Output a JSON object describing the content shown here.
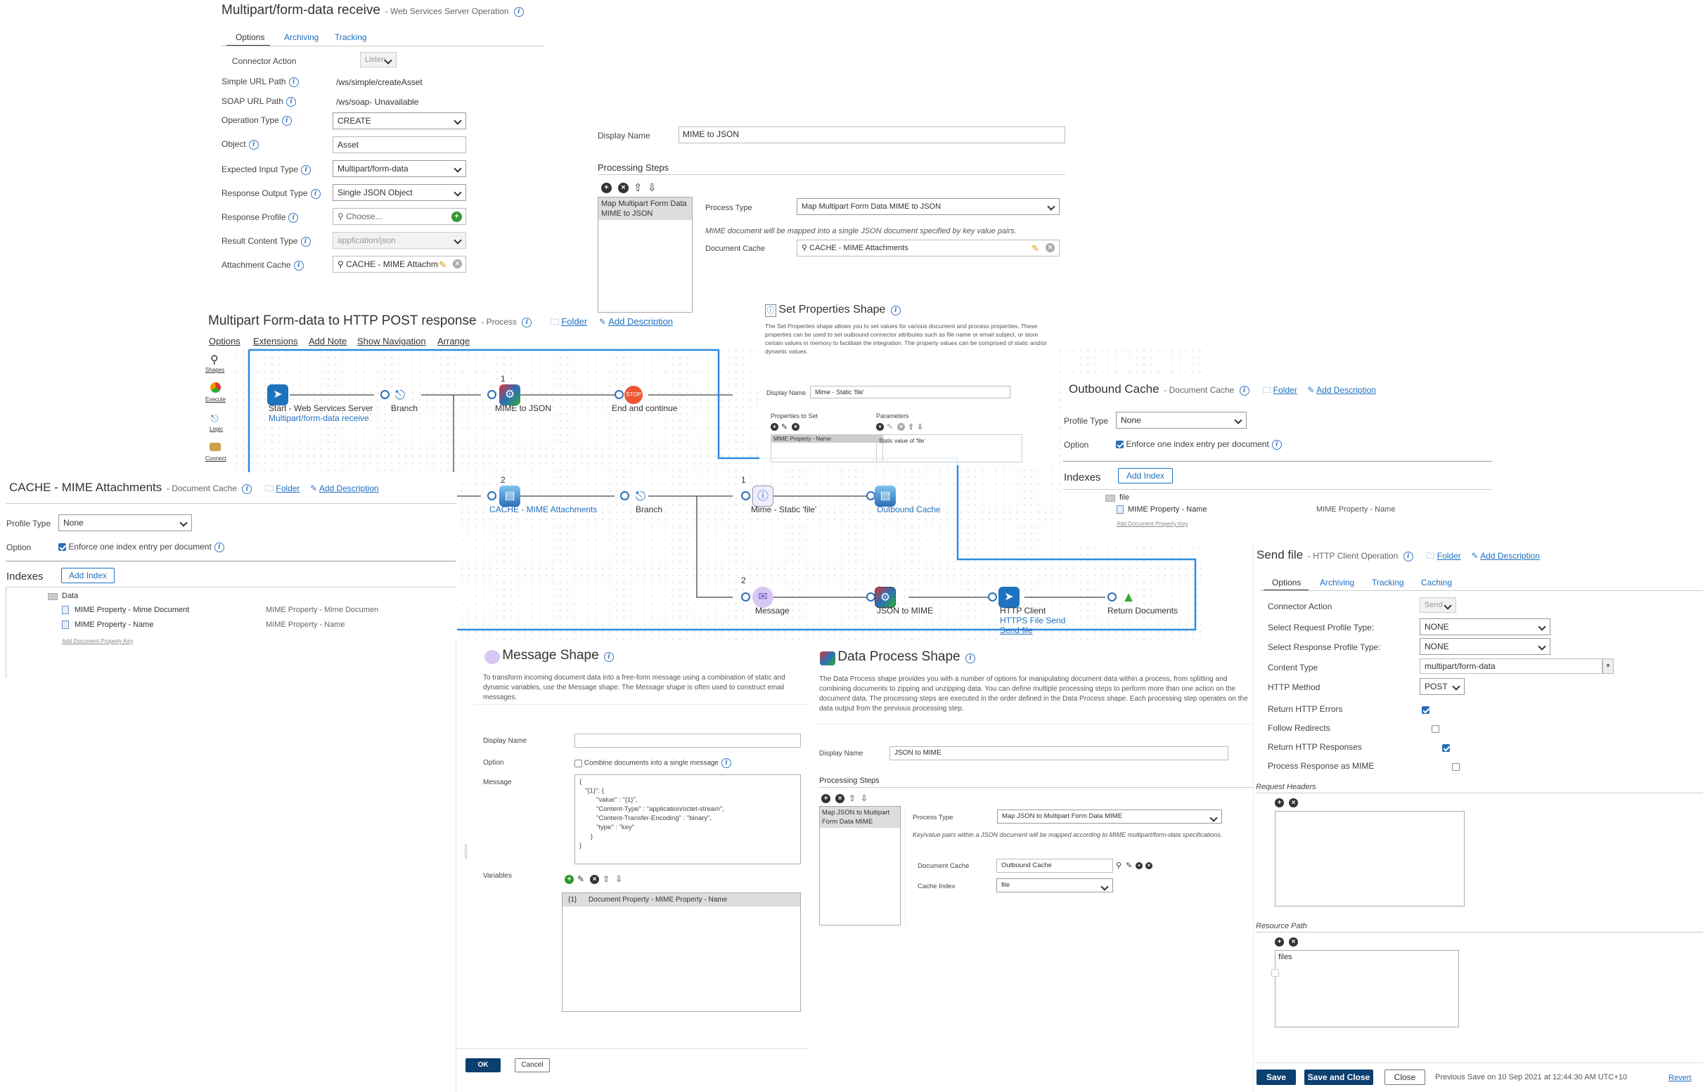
{
  "ws_op": {
    "title": "Multipart/form-data receive",
    "subtitle": "Web Services Server Operation",
    "tabs": [
      "Options",
      "Archiving",
      "Tracking"
    ],
    "connector_action_label": "Connector Action",
    "connector_action_value": "Listen",
    "fields": {
      "simple_url_label": "Simple URL Path",
      "simple_url_value": "/ws/simple/createAsset",
      "soap_url_label": "SOAP URL Path",
      "soap_url_value": "/ws/soap- Unavailable",
      "operation_type_label": "Operation Type",
      "operation_type_value": "CREATE",
      "object_label": "Object",
      "object_value": "Asset",
      "input_type_label": "Expected Input Type",
      "input_type_value": "Multipart/form-data",
      "output_type_label": "Response Output Type",
      "output_type_value": "Single JSON Object",
      "response_profile_label": "Response Profile",
      "response_profile_placeholder": "Choose...",
      "result_content_label": "Result Content Type",
      "result_content_value": "application/json",
      "attachment_cache_label": "Attachment Cache",
      "attachment_cache_value": "CACHE - MIME Attachm"
    }
  },
  "dp1": {
    "display_name_label": "Display Name",
    "display_name_value": "MIME to JSON",
    "processing_steps_label": "Processing Steps",
    "step_item": "Map Multipart Form Data MIME to JSON",
    "process_type_label": "Process Type",
    "process_type_value": "Map Multipart Form Data MIME to JSON",
    "note": "MIME document will be mapped into a single JSON document specified by key value pairs.",
    "doc_cache_label": "Document Cache",
    "doc_cache_value": "CACHE - MIME Attachments"
  },
  "process": {
    "title": "Multipart Form-data to HTTP POST response",
    "subtitle": "Process",
    "folder": "Folder",
    "add_description": "Add Description",
    "tabs": [
      "Options",
      "Extensions",
      "Add Note",
      "Show Navigation",
      "Arrange"
    ],
    "palette": [
      "Shapes",
      "Execute",
      "Logic",
      "Connect"
    ],
    "nodes": {
      "start": "Start - Web Services Server",
      "start_sub": "Multipart/form-data receive",
      "branch1": "Branch",
      "mime_to_json": "MIME to JSON",
      "end_continue": "End and continue",
      "cache": "CACHE - MIME Attachments",
      "branch2": "Branch",
      "mime_static": "Mime - Static 'file'",
      "outbound_cache": "Outbound Cache",
      "message": "Message",
      "json_to_mime": "JSON to MIME",
      "http_client": "HTTP Client",
      "http_sub1": "HTTPS File Send",
      "http_sub2": "Send file",
      "return_docs": "Return Documents"
    },
    "branch_nums": [
      "1",
      "2",
      "1",
      "2"
    ]
  },
  "set_props": {
    "title": "Set Properties Shape",
    "desc": "The Set Properties shape allows you to set values for various document and process properties. These properties can be used to set outbound connector attributes such as file name or email subject, or store certain values in memory to facilitate the integration. The property values can be comprised of static and/or dynamic values.",
    "display_name_label": "Display Name",
    "display_name_value": "Mime - Static 'file'",
    "props_to_set_label": "Properties to Set",
    "params_label": "Parameters",
    "prop_item": "MIME Property - Name",
    "param_item": "Static value of 'file'"
  },
  "outbound": {
    "title": "Outbound Cache",
    "subtitle": "Document Cache",
    "folder": "Folder",
    "add_description": "Add Description",
    "profile_type_label": "Profile Type",
    "profile_type_value": "None",
    "option_label": "Option",
    "option_text": "Enforce one index entry per document",
    "indexes_label": "Indexes",
    "add_index": "Add Index",
    "tree_root": "file",
    "tree_item": "MIME Property - Name",
    "tree_item_val": "MIME Property - Name",
    "add_key": "Add Document Property Key"
  },
  "cache_mime": {
    "title": "CACHE - MIME Attachments",
    "subtitle": "Document Cache",
    "folder": "Folder",
    "add_description": "Add Description",
    "profile_type_label": "Profile Type",
    "profile_type_value": "None",
    "option_label": "Option",
    "option_text": "Enforce one index entry per document",
    "indexes_label": "Indexes",
    "add_index": "Add Index",
    "tree_root": "Data",
    "items": [
      {
        "name": "MIME Property - Mime Document",
        "val": "MIME Property - Mime Documen"
      },
      {
        "name": "MIME Property - Name",
        "val": "MIME Property - Name"
      }
    ],
    "add_key": "Add Document Property Key"
  },
  "message": {
    "title": "Message Shape",
    "desc": "To transform incoming document data into a free-form message using a combination of static and dynamic variables, use the Message shape. The Message shape is often used to construct email messages.",
    "display_name_label": "Display Name",
    "display_name_value": "",
    "option_label": "Option",
    "option_text": "Combine documents into a single message",
    "message_label": "Message",
    "message_lines": [
      "{",
      "\"{1}\": {",
      "\"value\" : \"{1}\",",
      "\"Content-Type\" : \"application/octet-stream\",",
      "\"Content-Transfer-Encoding\" : \"binary\",",
      "\"type\" : \"key\"",
      "}",
      "}"
    ],
    "variables_label": "Variables",
    "variable_item": "{1}      Document Property - MIME Property - Name",
    "ok": "OK",
    "cancel": "Cancel"
  },
  "dp2": {
    "title": "Data Process Shape",
    "desc": "The Data Process shape provides you with a number of options for manipulating document data within a process, from splitting and combining documents to zipping and unzipping data. You can define multiple processing steps to perform more than one action on the document data. The processing steps are executed in the order defined in the Data Process shape. Each processing step operates on the data output from the previous processing step.",
    "display_name_label": "Display Name",
    "display_name_value": "JSON to MIME",
    "processing_steps_label": "Processing Steps",
    "step_item": "Map JSON to Multipart Form Data MIME",
    "process_type_label": "Process Type",
    "process_type_value": "Map JSON to Multipart Form Data MIME",
    "note": "Key/value pairs within a JSON document will be mapped according to MIME multipart/form-data specifications.",
    "doc_cache_label": "Document Cache",
    "doc_cache_value": "Outbound Cache",
    "cache_index_label": "Cache Index",
    "cache_index_value": "file"
  },
  "send_file": {
    "title": "Send file",
    "subtitle": "HTTP Client Operation",
    "folder": "Folder",
    "add_description": "Add Description",
    "tabs": [
      "Options",
      "Archiving",
      "Tracking",
      "Caching"
    ],
    "connector_action_label": "Connector Action",
    "connector_action_value": "Send",
    "req_profile_label": "Select Request Profile Type:",
    "req_profile_value": "NONE",
    "resp_profile_label": "Select Response Profile Type:",
    "resp_profile_value": "NONE",
    "content_type_label": "Content Type",
    "content_type_value": "multipart/form-data",
    "http_method_label": "HTTP Method",
    "http_method_value": "POST",
    "return_errors_label": "Return HTTP Errors",
    "follow_redirects_label": "Follow Redirects",
    "return_responses_label": "Return HTTP Responses",
    "process_mime_label": "Process Response as MIME",
    "request_headers_label": "Request Headers",
    "resource_path_label": "Resource Path",
    "resource_path_item": "files",
    "save": "Save",
    "save_close": "Save and Close",
    "close": "Close",
    "previous_save": "Previous Save on 10 Sep 2021 at 12:44:30 AM UTC+10",
    "revert": "Revert"
  }
}
